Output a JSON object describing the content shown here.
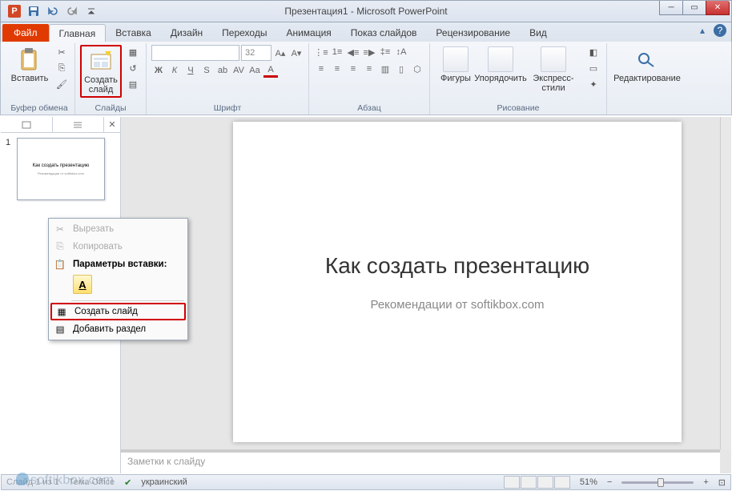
{
  "window": {
    "title": "Презентация1 - Microsoft PowerPoint",
    "app_letter": "P"
  },
  "tabs": {
    "file": "Файл",
    "items": [
      "Главная",
      "Вставка",
      "Дизайн",
      "Переходы",
      "Анимация",
      "Показ слайдов",
      "Рецензирование",
      "Вид"
    ],
    "active_index": 0
  },
  "ribbon": {
    "clipboard": {
      "paste": "Вставить",
      "label": "Буфер обмена"
    },
    "slides": {
      "new_slide": "Создать\nслайд",
      "label": "Слайды"
    },
    "font": {
      "name_placeholder": "",
      "size_placeholder": "32",
      "label": "Шрифт"
    },
    "paragraph": {
      "label": "Абзац"
    },
    "drawing": {
      "shapes": "Фигуры",
      "arrange": "Упорядочить",
      "styles": "Экспресс-стили",
      "label": "Рисование"
    },
    "editing": {
      "label": "Редактирование"
    }
  },
  "slidepanel": {
    "slides": [
      {
        "num": "1",
        "title": "Как создать презентацию",
        "subtitle": "Рекомендации от softikbox.com"
      }
    ]
  },
  "slide": {
    "title": "Как создать презентацию",
    "subtitle": "Рекомендации от softikbox.com"
  },
  "notes_placeholder": "Заметки к слайду",
  "context_menu": {
    "cut": "Вырезать",
    "copy": "Копировать",
    "paste_header": "Параметры вставки:",
    "new_slide": "Создать слайд",
    "add_section": "Добавить раздел"
  },
  "statusbar": {
    "slide_info": "Слайд 1 из 1",
    "theme": "Тема Office",
    "language": "украинский",
    "zoom": "51%"
  },
  "watermark": "softikbox.com"
}
